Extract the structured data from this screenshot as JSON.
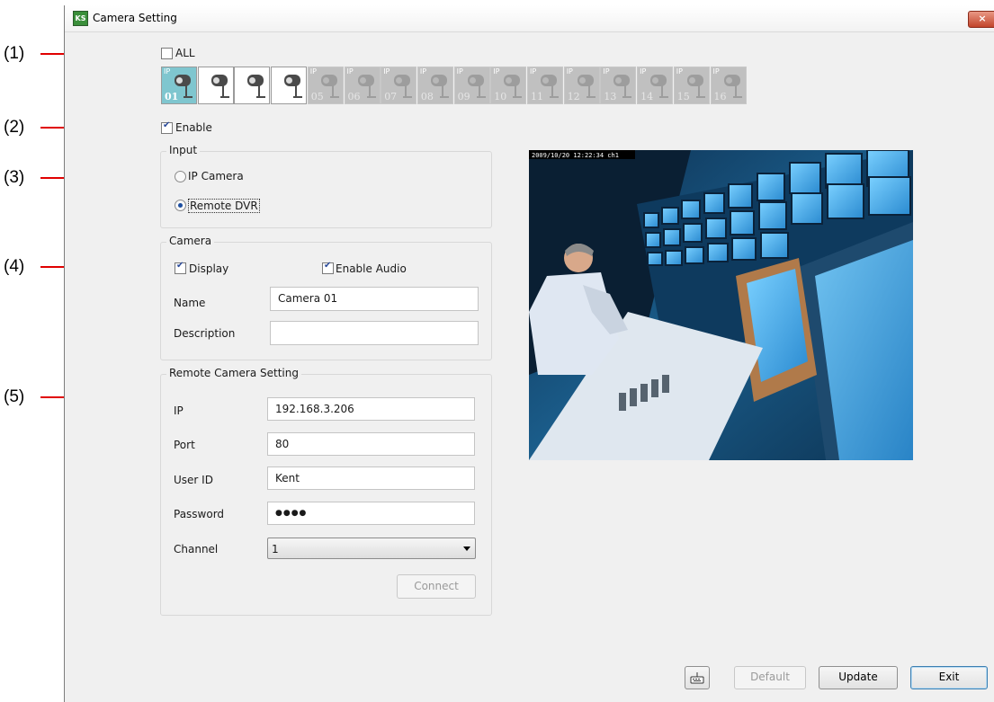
{
  "callouts": [
    "(1)",
    "(2)",
    "(3)",
    "(4)",
    "(5)"
  ],
  "window": {
    "title": "Camera Setting",
    "app_icon": "KS",
    "close_label": "×"
  },
  "all_checkbox": {
    "label": "ALL",
    "checked": false
  },
  "camera_tiles": [
    {
      "badge": "IP",
      "number": "01",
      "active": true,
      "selected": true
    },
    {
      "badge": "IP",
      "number": "02",
      "active": true,
      "selected": false
    },
    {
      "badge": "IP",
      "number": "03",
      "active": true,
      "selected": false
    },
    {
      "badge": "IP",
      "number": "04",
      "active": true,
      "selected": false
    },
    {
      "badge": "IP",
      "number": "05",
      "active": false,
      "selected": false
    },
    {
      "badge": "IP",
      "number": "06",
      "active": false,
      "selected": false
    },
    {
      "badge": "IP",
      "number": "07",
      "active": false,
      "selected": false
    },
    {
      "badge": "IP",
      "number": "08",
      "active": false,
      "selected": false
    },
    {
      "badge": "IP",
      "number": "09",
      "active": false,
      "selected": false
    },
    {
      "badge": "IP",
      "number": "10",
      "active": false,
      "selected": false
    },
    {
      "badge": "IP",
      "number": "11",
      "active": false,
      "selected": false
    },
    {
      "badge": "IP",
      "number": "12",
      "active": false,
      "selected": false
    },
    {
      "badge": "IP",
      "number": "13",
      "active": false,
      "selected": false
    },
    {
      "badge": "IP",
      "number": "14",
      "active": false,
      "selected": false
    },
    {
      "badge": "IP",
      "number": "15",
      "active": false,
      "selected": false
    },
    {
      "badge": "IP",
      "number": "16",
      "active": false,
      "selected": false
    }
  ],
  "enable_checkbox": {
    "label": "Enable",
    "checked": true
  },
  "input_group": {
    "title": "Input",
    "options": [
      {
        "label": "IP Camera",
        "selected": false
      },
      {
        "label": "Remote DVR",
        "selected": true
      }
    ]
  },
  "camera_group": {
    "title": "Camera",
    "display": {
      "label": "Display",
      "checked": true
    },
    "enable_audio": {
      "label": "Enable Audio",
      "checked": true
    },
    "name_label": "Name",
    "name_value": "Camera 01",
    "description_label": "Description",
    "description_value": ""
  },
  "remote_group": {
    "title": "Remote Camera Setting",
    "ip_label": "IP",
    "ip_value": "192.168.3.206",
    "port_label": "Port",
    "port_value": "80",
    "userid_label": "User ID",
    "userid_value": "Kent",
    "password_label": "Password",
    "password_value": "●●●●",
    "channel_label": "Channel",
    "channel_value": "1",
    "connect_label": "Connect"
  },
  "preview": {
    "overlay_text": "2009/10/20 12:22:34 ch1"
  },
  "footer": {
    "keyboard_icon": "keyboard-icon",
    "default_label": "Default",
    "update_label": "Update",
    "exit_label": "Exit"
  },
  "colors": {
    "callout_line": "#e00000",
    "selected_tile": "#7fc6cf",
    "window_bg": "#f0f0f0"
  }
}
